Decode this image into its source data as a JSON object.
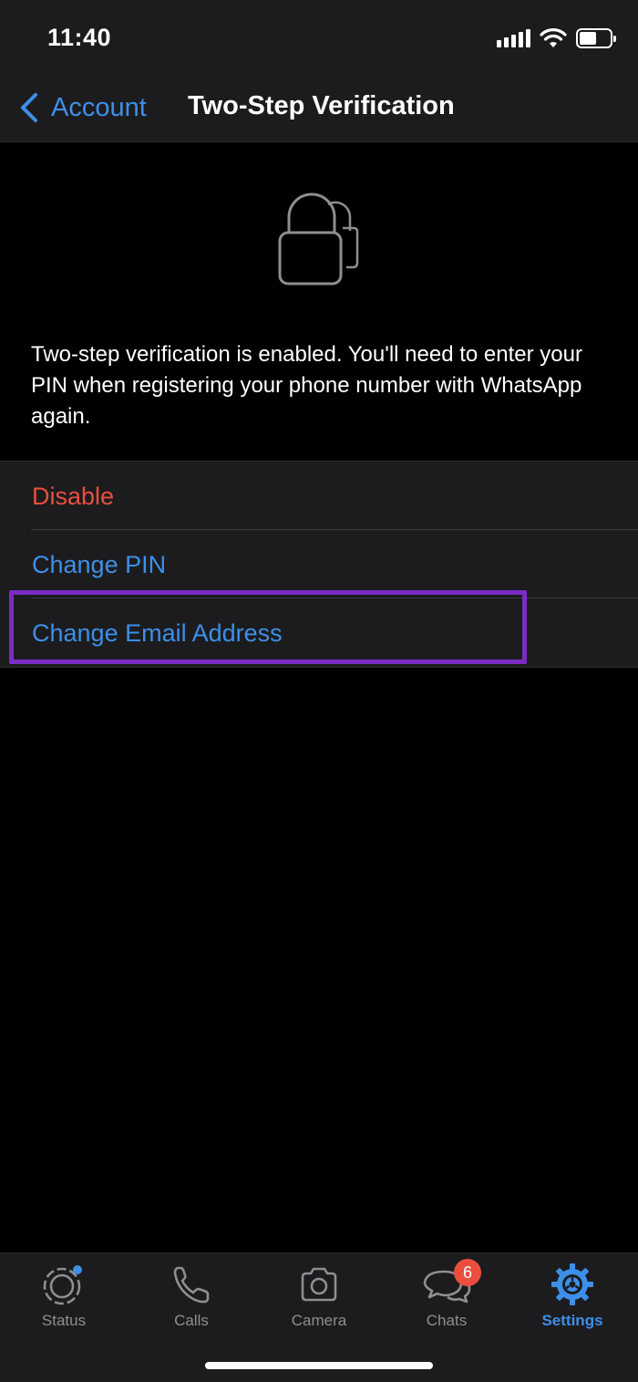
{
  "status_bar": {
    "time": "11:40"
  },
  "nav": {
    "back_label": "Account",
    "title": "Two-Step Verification"
  },
  "description": "Two-step verification is enabled. You'll need to enter your PIN when registering your phone number with WhatsApp again.",
  "options": [
    {
      "label": "Disable"
    },
    {
      "label": "Change PIN"
    },
    {
      "label": "Change Email Address"
    }
  ],
  "tabs": [
    {
      "label": "Status",
      "icon": "status-icon"
    },
    {
      "label": "Calls",
      "icon": "phone-icon"
    },
    {
      "label": "Camera",
      "icon": "camera-icon"
    },
    {
      "label": "Chats",
      "icon": "chat-bubbles-icon",
      "badge": "6"
    },
    {
      "label": "Settings",
      "icon": "gear-icon",
      "active": true
    }
  ],
  "colors": {
    "accent": "#3d8fe8",
    "destructive": "#eb4e3d",
    "highlight": "#7a2cc4",
    "background": "#000000",
    "surface": "#1c1c1e"
  }
}
